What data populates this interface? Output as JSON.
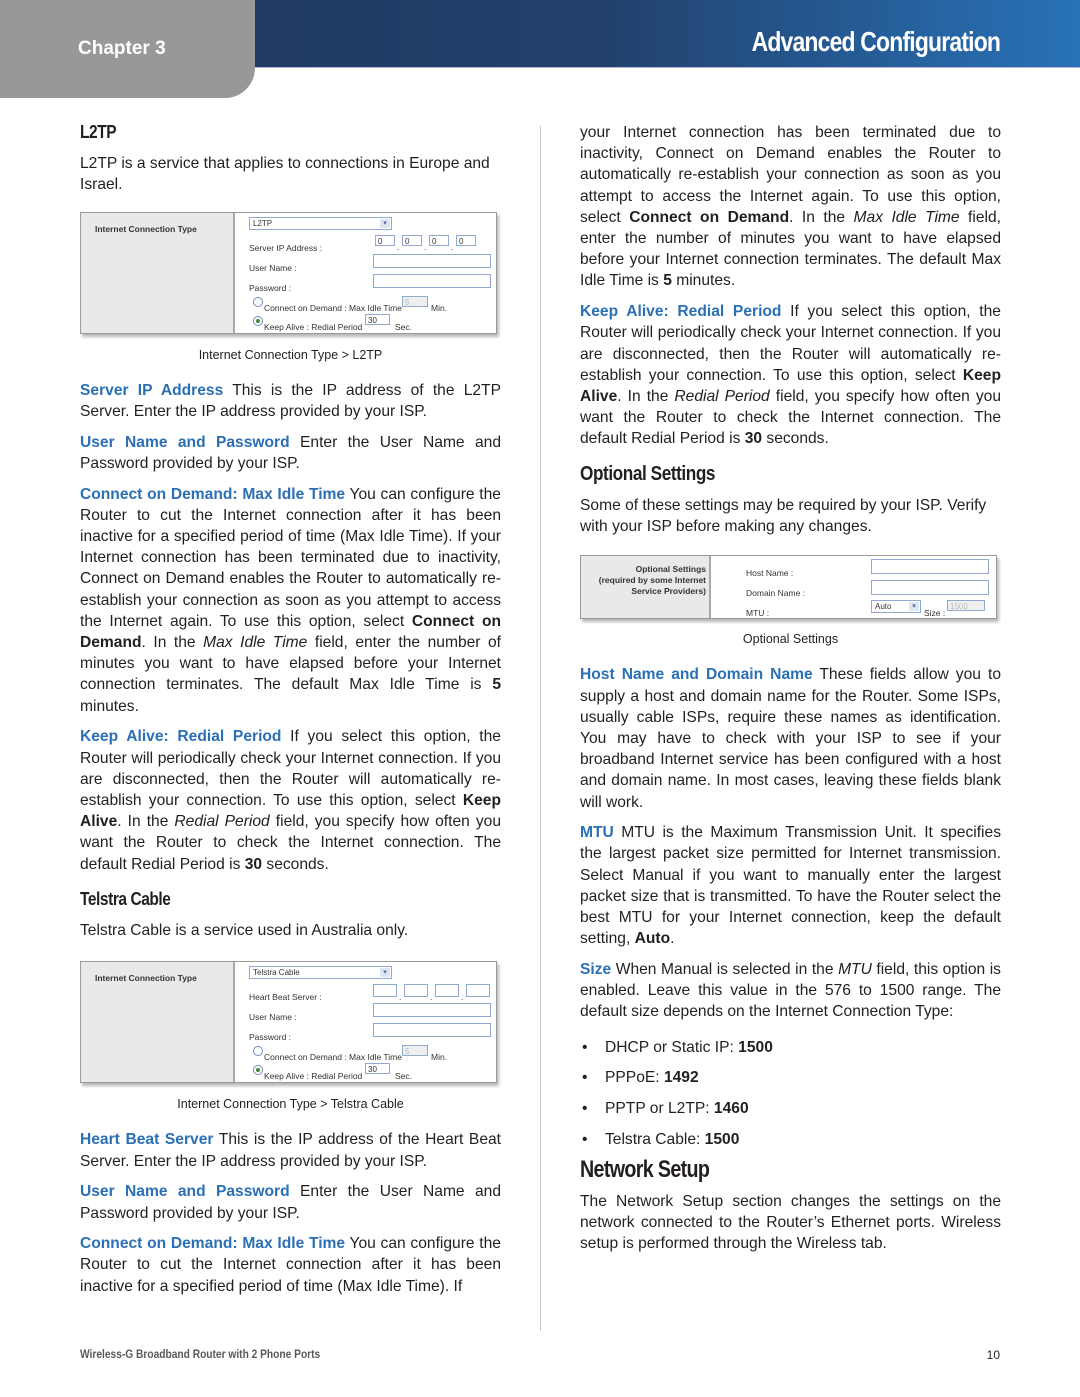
{
  "header": {
    "chapter": "Chapter 3",
    "title": "Advanced Configuration",
    "colors": {
      "bar_dark": "#1e355c",
      "bar_light": "#2872b8",
      "tab": "#97989a",
      "keyword": "#2b6fb5"
    }
  },
  "left": {
    "l2tp": {
      "heading": "L2TP",
      "intro": "L2TP is a service that applies to connections in Europe and Israel.",
      "screenshot": {
        "section_label": "Internet Connection Type",
        "type_value": "L2TP",
        "server_ip_label": "Server IP Address :",
        "ip": [
          "0",
          "0",
          "0",
          "0"
        ],
        "user_label": "User Name :",
        "password_label": "Password :",
        "cod_label": "Connect on Demand : Max Idle Time",
        "cod_value": "5",
        "cod_unit": "Min.",
        "ka_label": "Keep Alive : Redial Period",
        "ka_value": "30",
        "ka_unit": "Sec."
      },
      "caption": "Internet Connection Type > L2TP",
      "server_ip_term": "Server IP Address",
      "server_ip_text": " This is the IP address of the L2TP Server. Enter the IP address provided by your ISP.",
      "user_term": "User Name and Password",
      "user_text": " Enter the User Name and Password provided by your ISP.",
      "cod_term": "Connect on Demand: Max Idle Time",
      "cod_text_1": "  You can configure the Router to cut the Internet connection after it has been inactive for a specified period of time (Max Idle Time). If your Internet connection has been terminated due to inactivity, Connect on Demand enables the Router to automatically re-establish your connection as soon as you attempt to access the Internet again. To use this option, select ",
      "cod_bold": "Connect on Demand",
      "cod_text_2": ". In the ",
      "cod_italic": "Max Idle Time",
      "cod_text_3": " field, enter the number of minutes you want to have elapsed before your Internet connection terminates. The default Max Idle Time is ",
      "cod_default": "5",
      "cod_text_4": " minutes.",
      "ka_term": "Keep Alive: Redial Period",
      "ka_text_1": " If you select this option, the Router will periodically check your Internet connection. If you are disconnected, then the Router will automatically re-establish your connection. To use this option, select ",
      "ka_bold": "Keep Alive",
      "ka_text_2": ". In the ",
      "ka_italic": "Redial Period",
      "ka_text_3": " field, you specify how often you want the Router to check the Internet connection. The default Redial Period is ",
      "ka_default": "30",
      "ka_text_4": " seconds."
    },
    "telstra": {
      "heading": "Telstra Cable",
      "intro": "Telstra Cable is a service used in Australia only.",
      "screenshot": {
        "section_label": "Internet Connection Type",
        "type_value": "Telstra Cable",
        "hb_label": "Heart Beat Server :",
        "ip": [
          "",
          "",
          "",
          ""
        ],
        "user_label": "User Name :",
        "password_label": "Password :",
        "cod_label": "Connect on Demand : Max Idle Time",
        "cod_value": "5",
        "cod_unit": "Min.",
        "ka_label": "Keep Alive : Redial Period",
        "ka_value": "30",
        "ka_unit": "Sec."
      },
      "caption": "Internet Connection Type > Telstra Cable",
      "hb_term": "Heart Beat Server",
      "hb_text": "  This is the IP address of the Heart Beat Server. Enter the IP address provided by your ISP.",
      "user_term": "User Name and Password",
      "user_text": " Enter the User Name and Password provided by your ISP.",
      "cod_term": "Connect on Demand: Max Idle Time",
      "cod_text": "  You can configure the Router to cut the Internet connection after it has been inactive for a specified period of time (Max Idle Time). If"
    }
  },
  "right": {
    "cont_text_1": "your Internet connection has been terminated due to inactivity, Connect on Demand enables the Router to automatically re-establish your connection as soon as you attempt to access the Internet again. To use this option, select ",
    "cont_bold": "Connect on Demand",
    "cont_text_2": ". In the ",
    "cont_italic": "Max Idle Time",
    "cont_text_3": " field, enter the number of minutes you want to have elapsed before your Internet connection terminates. The default Max Idle Time is ",
    "cont_default": "5",
    "cont_text_4": " minutes.",
    "ka_term": "Keep Alive: Redial Period",
    "ka_text_1": " If you select this option, the Router will periodically check your Internet connection. If you are disconnected, then the Router will automatically re-establish your connection. To use this option, select ",
    "ka_bold": "Keep Alive",
    "ka_text_2": ". In the ",
    "ka_italic": "Redial Period",
    "ka_text_3": " field, you specify how often you want the Router to check the Internet connection. The default Redial Period is ",
    "ka_default": "30",
    "ka_text_4": " seconds.",
    "optional": {
      "heading": "Optional Settings",
      "intro": "Some of these settings may be required by your ISP. Verify with your ISP before making any changes.",
      "screenshot": {
        "section_label_1": "Optional Settings",
        "section_label_2": "(required by some Internet",
        "section_label_3": "Service Providers)",
        "host_label": "Host Name :",
        "domain_label": "Domain Name :",
        "mtu_label": "MTU :",
        "mtu_value": "Auto",
        "size_label": "Size :",
        "size_value": "1500"
      },
      "caption": "Optional Settings",
      "host_term": "Host Name and Domain Name",
      "host_text": "  These fields allow you to supply a host and domain name for the Router. Some ISPs, usually cable ISPs, require these names as identification. You may have to check with your ISP to see if your broadband Internet service has been configured with a host and domain name. In most cases, leaving these fields blank will work.",
      "mtu_term": "MTU",
      "mtu_text_1": "  MTU is the Maximum Transmission Unit. It specifies the largest packet size permitted for Internet transmission. Select Manual if you want to manually enter the largest packet size that is transmitted. To have the Router select the best MTU for your Internet connection, keep the default setting, ",
      "mtu_bold": "Auto",
      "mtu_text_2": ".",
      "size_term": "Size",
      "size_text_1": "  When Manual is selected in the ",
      "size_italic": "MTU",
      "size_text_2": " field, this option is enabled. Leave this value in the 576 to 1500 range. The default size depends on the Internet Connection Type:",
      "bullets": [
        {
          "label": "DHCP or Static IP: ",
          "value": "1500"
        },
        {
          "label": "PPPoE: ",
          "value": "1492"
        },
        {
          "label": "PPTP or L2TP: ",
          "value": "1460"
        },
        {
          "label": "Telstra Cable: ",
          "value": "1500"
        }
      ]
    },
    "network": {
      "heading": "Network Setup",
      "text": "The Network Setup section changes the settings on the network connected to the Router’s Ethernet ports. Wireless setup is performed through the Wireless tab."
    }
  },
  "footer": {
    "product": "Wireless-G Broadband Router with 2 Phone Ports",
    "page": "10"
  }
}
